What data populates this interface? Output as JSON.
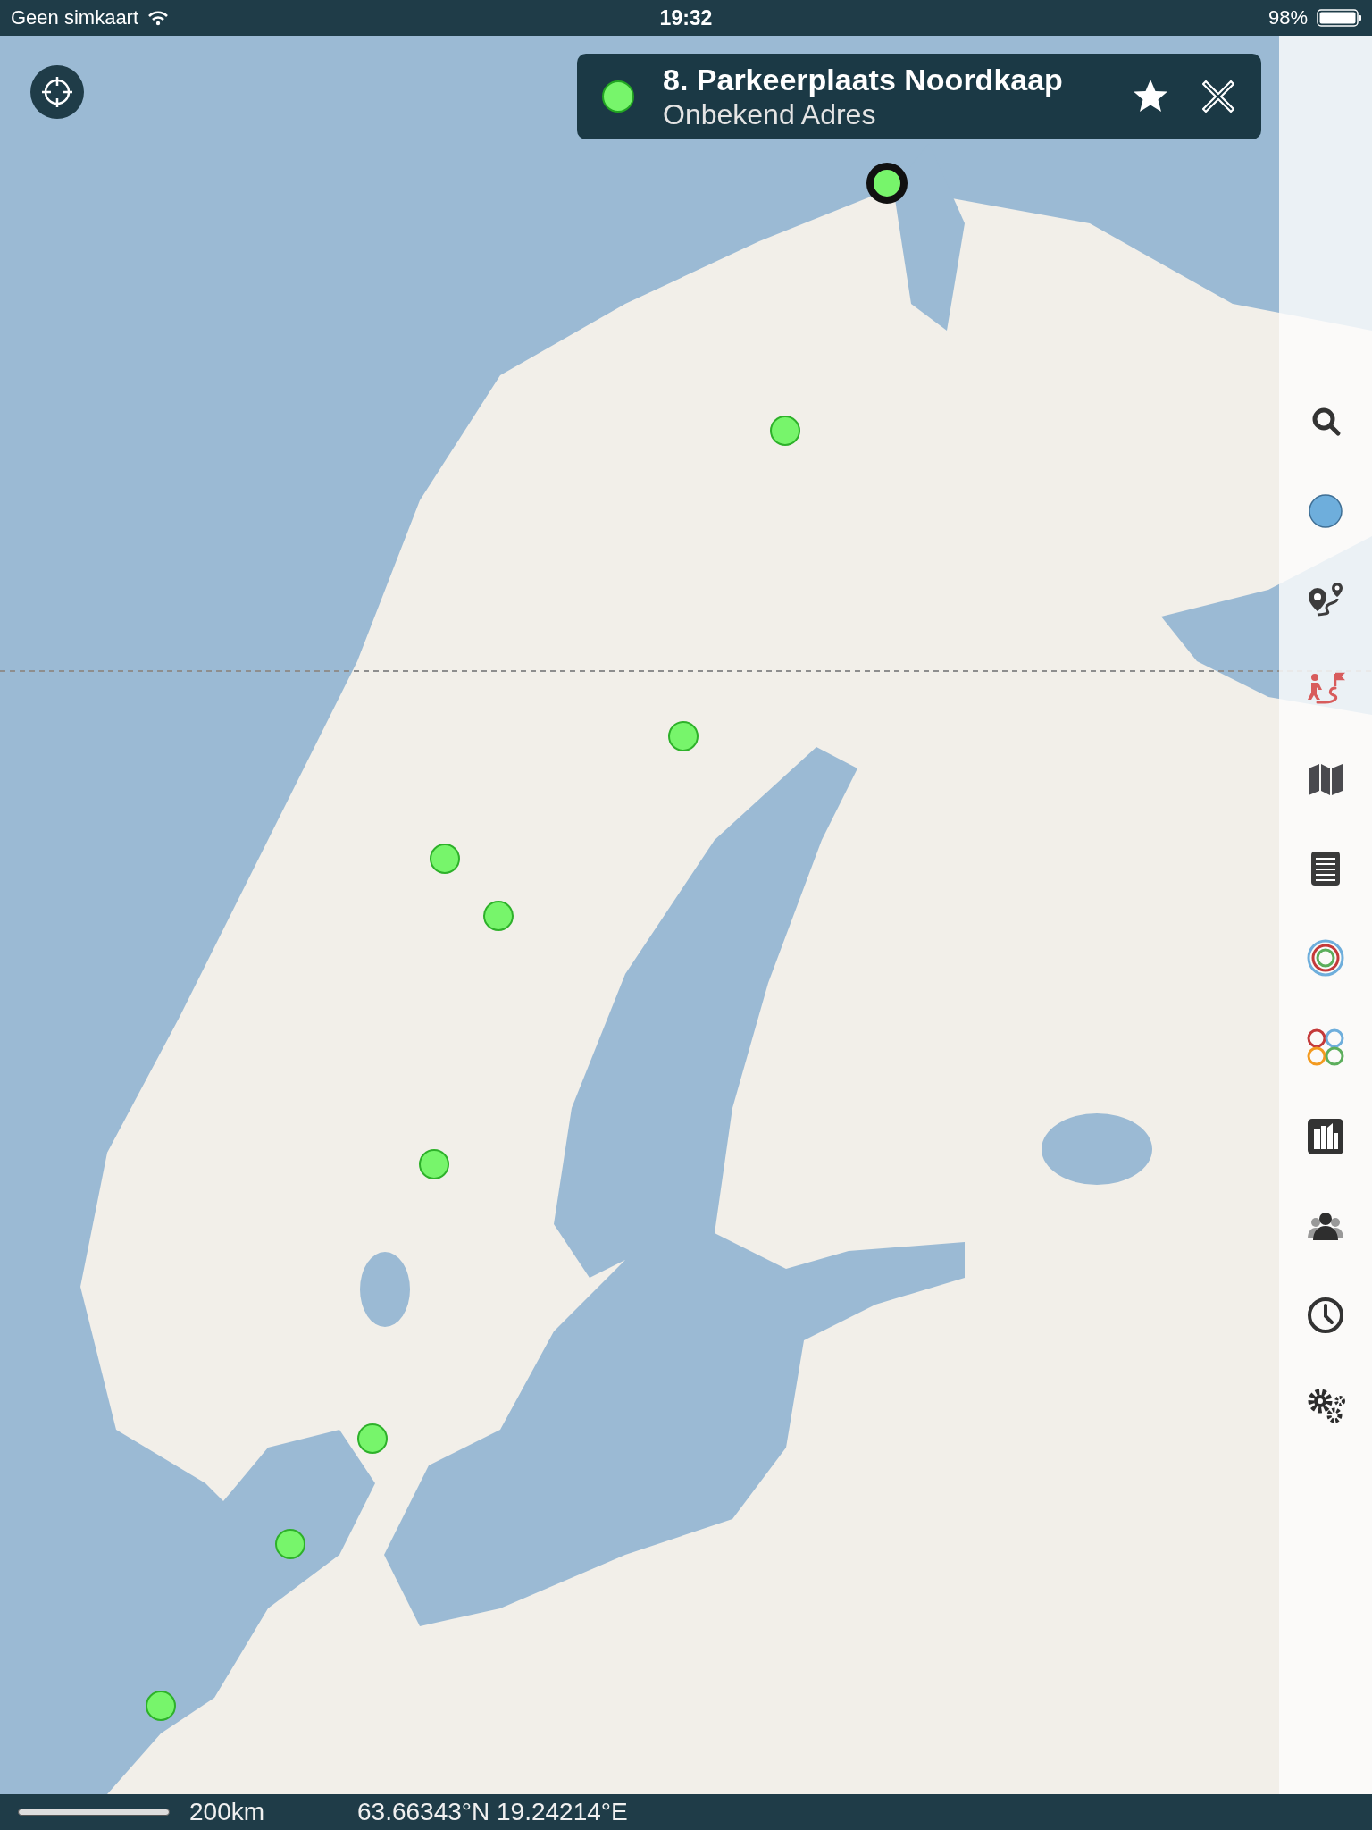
{
  "status_bar": {
    "carrier": "Geen simkaart",
    "time": "19:32",
    "battery": "98%"
  },
  "place_card": {
    "title": "8. Parkeerplaats Noordkaap",
    "subtitle": "Onbekend Adres"
  },
  "map": {
    "kind": "picture",
    "markers": [
      {
        "selected": true
      },
      {
        "selected": false
      },
      {
        "selected": false
      },
      {
        "selected": false
      },
      {
        "selected": false
      },
      {
        "selected": false
      },
      {
        "selected": false
      },
      {
        "selected": false
      },
      {
        "selected": false
      }
    ]
  },
  "bottom_bar": {
    "scale": "200km",
    "coordinates": "63.66343°N 19.24214°E"
  }
}
